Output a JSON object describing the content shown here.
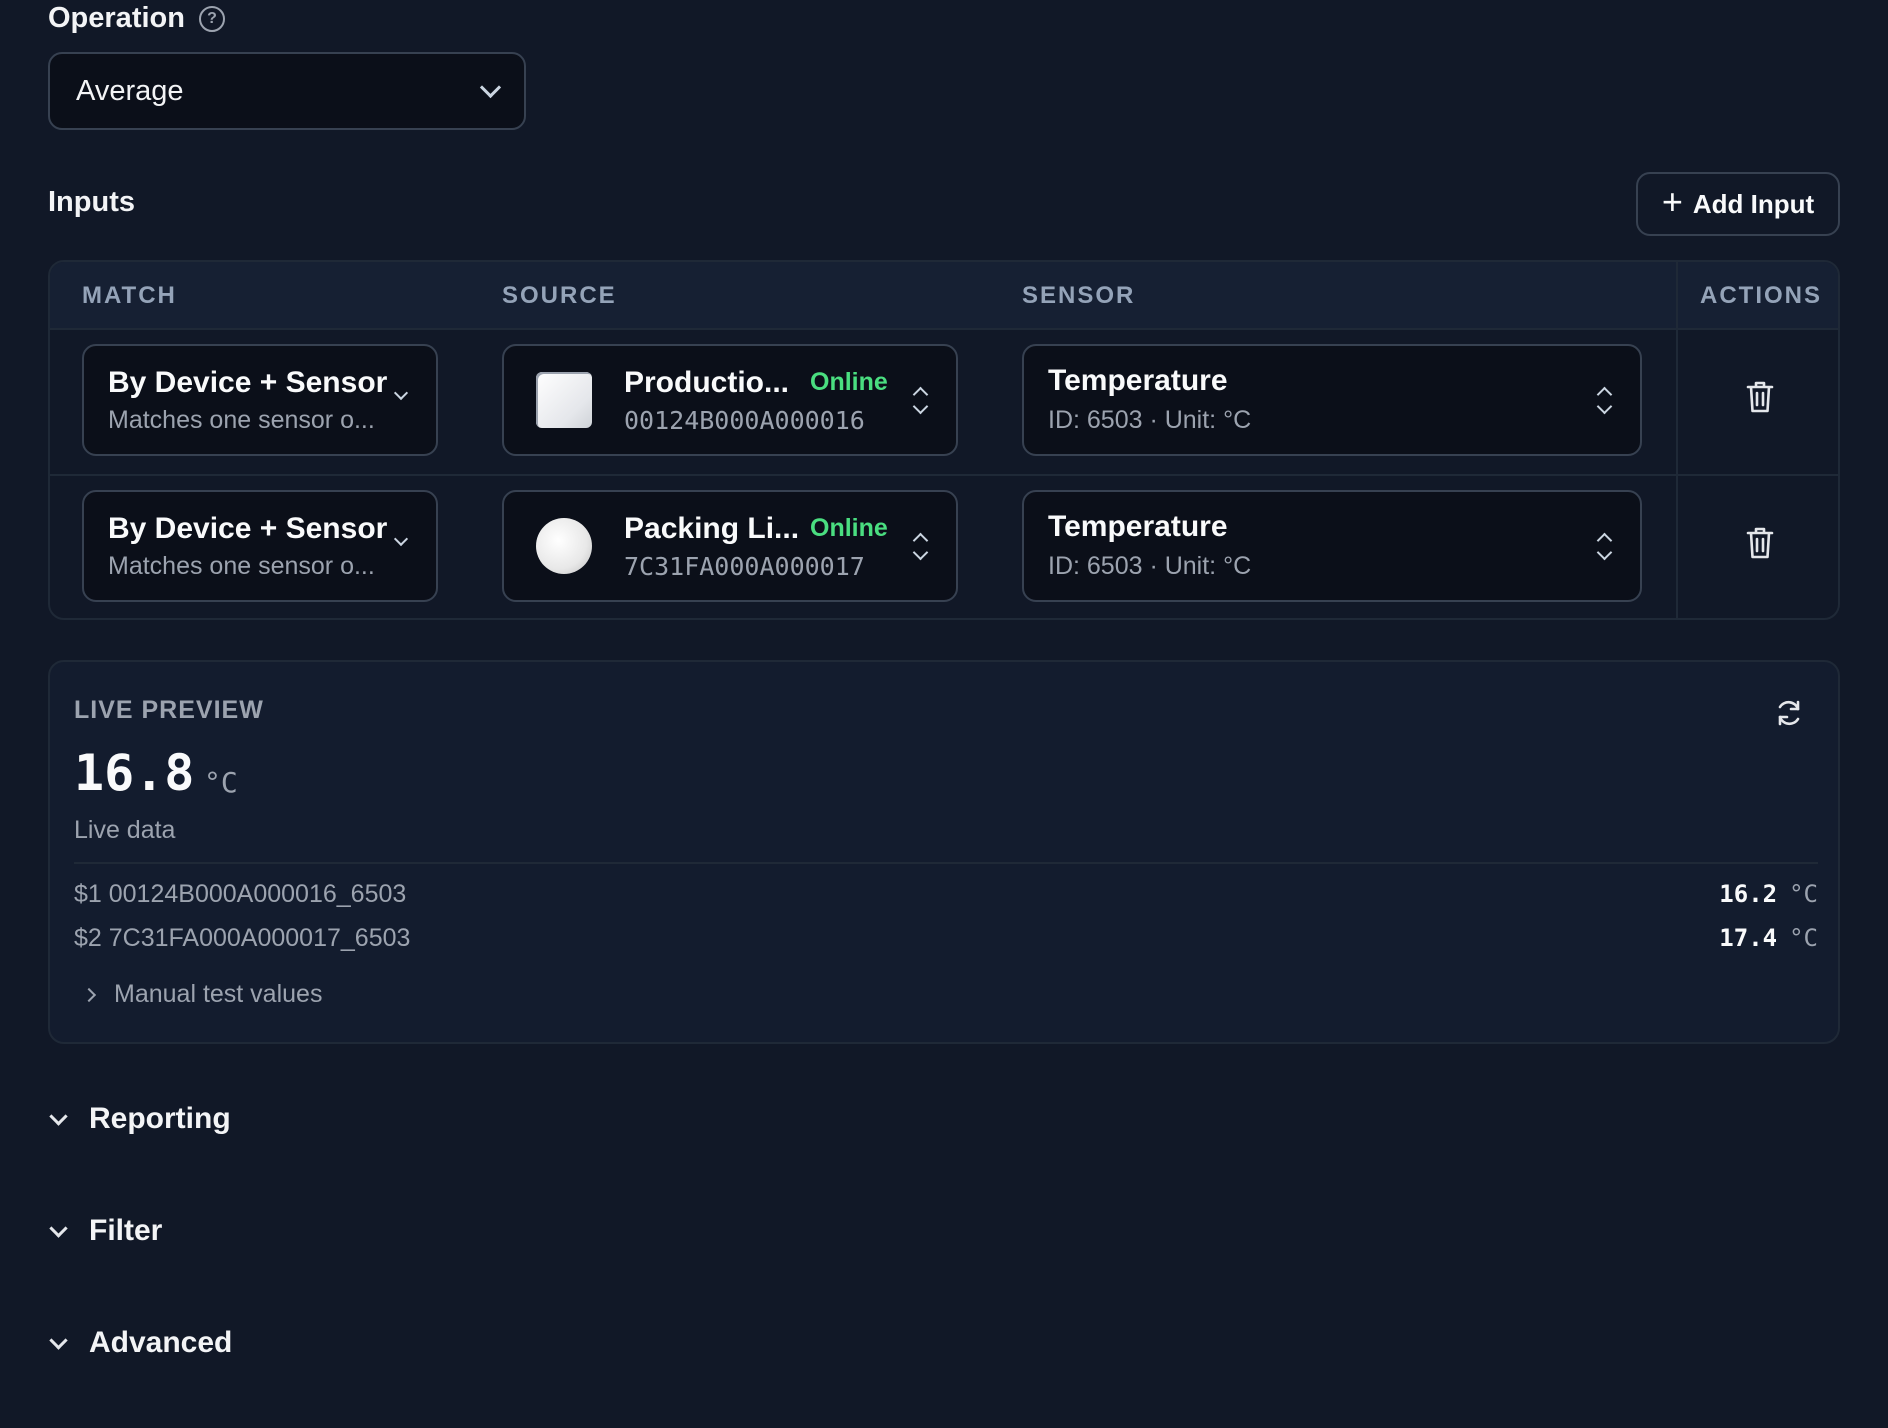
{
  "operation": {
    "label": "Operation",
    "help_icon": "question-circle-icon",
    "selected": "Average"
  },
  "inputs": {
    "title": "Inputs",
    "add_label": "Add Input",
    "columns": [
      "MATCH",
      "SOURCE",
      "SENSOR",
      "ACTIONS"
    ],
    "rows": [
      {
        "match_title": "By Device + Sensor",
        "match_desc": "Matches one sensor o...",
        "source_name": "Productio...",
        "source_status": "Online",
        "source_id": "00124B000A000016",
        "sensor_name": "Temperature",
        "sensor_meta": "ID: 6503 · Unit: °C"
      },
      {
        "match_title": "By Device + Sensor",
        "match_desc": "Matches one sensor o...",
        "source_name": "Packing Li...",
        "source_status": "Online",
        "source_id": "7C31FA000A000017",
        "sensor_name": "Temperature",
        "sensor_meta": "ID: 6503 · Unit: °C"
      }
    ]
  },
  "preview": {
    "title": "LIVE PREVIEW",
    "value": "16.8",
    "unit": "°C",
    "subtitle": "Live data",
    "items": [
      {
        "label": "$1 00124B000A000016_6503",
        "value": "16.2",
        "unit": "°C"
      },
      {
        "label": "$2 7C31FA000A000017_6503",
        "value": "17.4",
        "unit": "°C"
      }
    ],
    "manual_label": "Manual test values"
  },
  "sections": {
    "reporting": "Reporting",
    "filter": "Filter",
    "advanced": "Advanced"
  },
  "colors": {
    "background": "#111827",
    "online": "#4ade80",
    "border": "#374151"
  }
}
